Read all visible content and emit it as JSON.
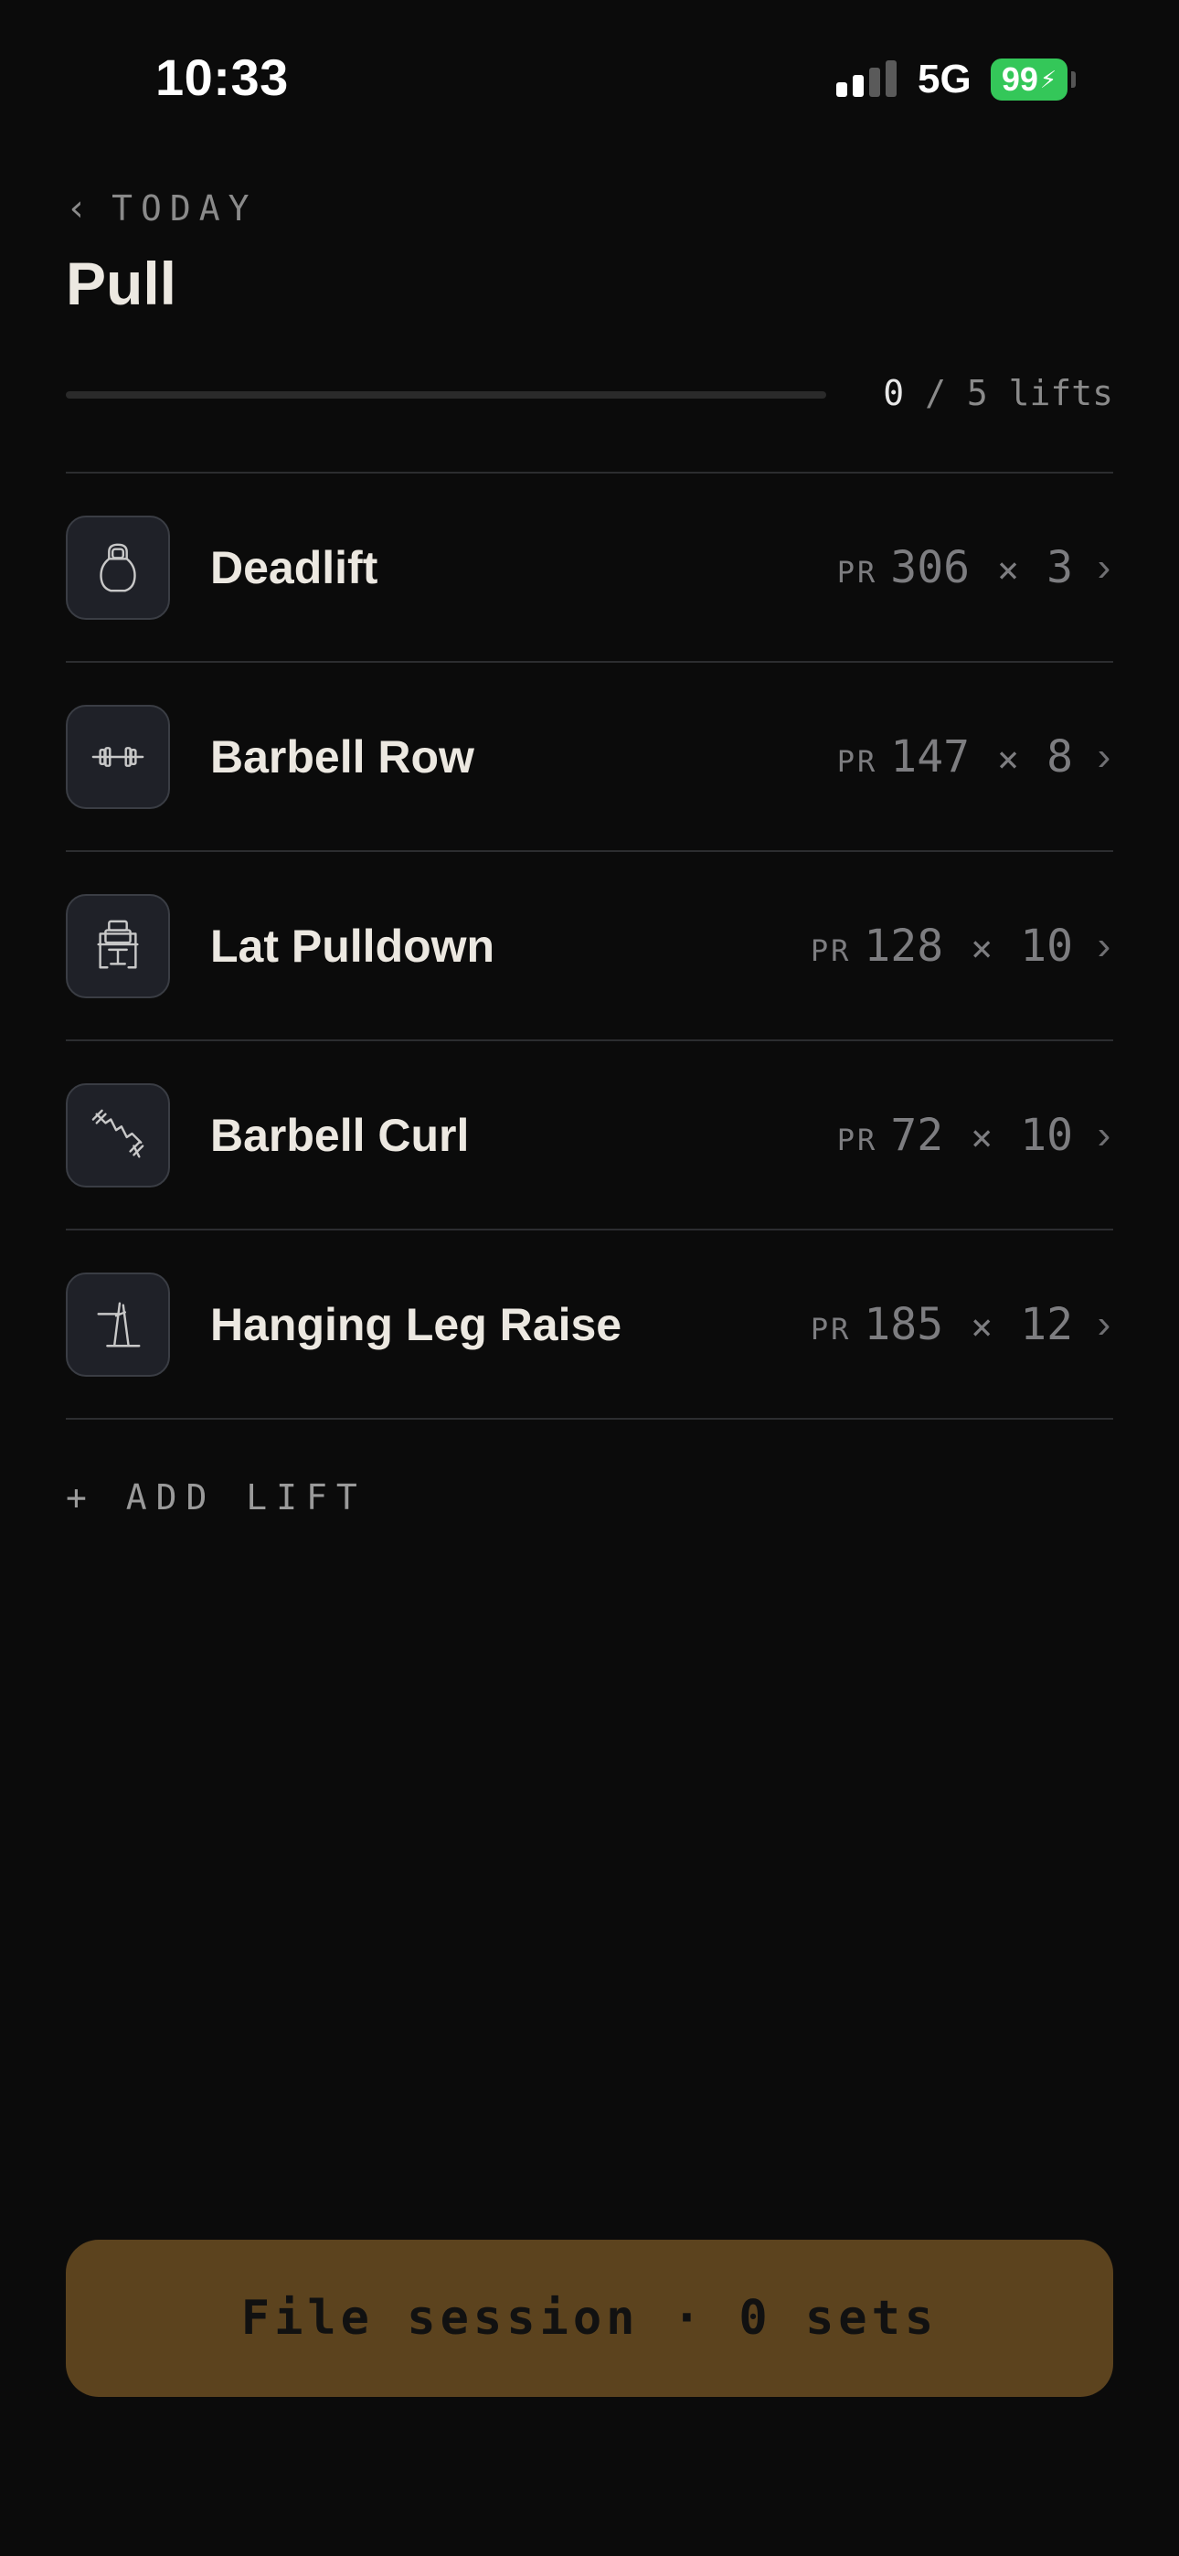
{
  "status_bar": {
    "time": "10:33",
    "network": "5G",
    "battery": "99"
  },
  "header": {
    "back_label": "TODAY",
    "title": "Pull"
  },
  "progress": {
    "done": "0",
    "separator": " / ",
    "total": "5",
    "unit": " lifts",
    "fraction": 0
  },
  "lifts": [
    {
      "name": "Deadlift",
      "pr_label": "PR",
      "weight": "306",
      "times": "×",
      "reps": "3",
      "icon": "kettlebell-icon"
    },
    {
      "name": "Barbell Row",
      "pr_label": "PR",
      "weight": "147",
      "times": "×",
      "reps": "8",
      "icon": "dumbbell-icon"
    },
    {
      "name": "Lat Pulldown",
      "pr_label": "PR",
      "weight": "128",
      "times": "×",
      "reps": "10",
      "icon": "pulldown-machine-icon"
    },
    {
      "name": "Barbell Curl",
      "pr_label": "PR",
      "weight": "72",
      "times": "×",
      "reps": "10",
      "icon": "curl-bar-icon"
    },
    {
      "name": "Hanging Leg Raise",
      "pr_label": "PR",
      "weight": "185",
      "times": "×",
      "reps": "12",
      "icon": "leg-raise-station-icon"
    }
  ],
  "add_lift_label": "+ ADD LIFT",
  "cta": {
    "label": "File session · 0 sets"
  },
  "colors": {
    "background": "#0b0b0b",
    "cta": "#5c431e",
    "battery": "#34c759",
    "divider": "#2c2d30"
  }
}
